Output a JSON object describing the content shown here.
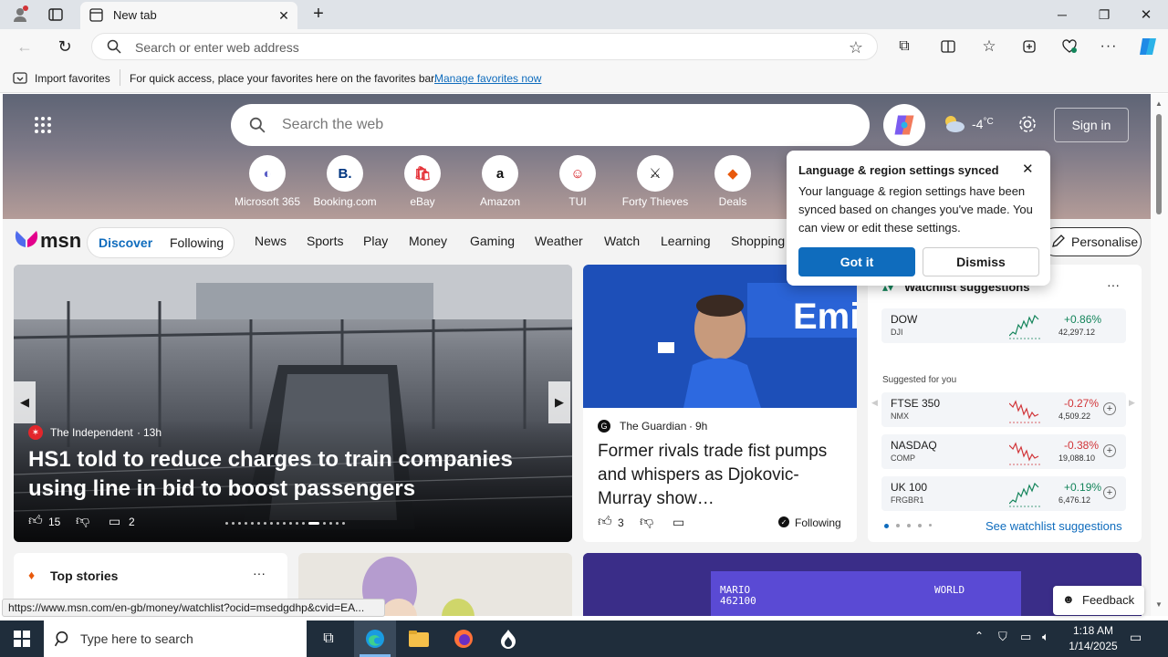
{
  "browser": {
    "tab_title": "New tab",
    "address_placeholder": "Search or enter web address",
    "favbar": {
      "import_label": "Import favorites",
      "hint": "For quick access, place your favorites here on the favorites bar.",
      "manage_link": "Manage favorites now"
    },
    "status_url": "https://www.msn.com/en-gb/money/watchlist?ocid=msedgdhp&cvid=EA..."
  },
  "msn": {
    "search_placeholder": "Search the web",
    "weather_temp": "-4",
    "weather_unit": "°C",
    "sign_in": "Sign in",
    "quick_links": [
      {
        "label": "Microsoft 365",
        "glyph": "◐",
        "color": "#5b5fc7"
      },
      {
        "label": "Booking.com",
        "glyph": "B.",
        "color": "#003580"
      },
      {
        "label": "eBay",
        "glyph": "🛍",
        "color": "#e53238"
      },
      {
        "label": "Amazon",
        "glyph": "a",
        "color": "#111111"
      },
      {
        "label": "TUI",
        "glyph": "☺",
        "color": "#d40e14"
      },
      {
        "label": "Forty Thieves",
        "glyph": "⚔",
        "color": "#111111"
      },
      {
        "label": "Deals",
        "glyph": "◆",
        "color": "#e8590c"
      }
    ],
    "logo_text": "msn",
    "feed_tabs": [
      "Discover",
      "Following"
    ],
    "nav_items": [
      "News",
      "Sports",
      "Play",
      "Money",
      "Gaming",
      "Weather",
      "Watch",
      "Learning",
      "Shopping"
    ],
    "personalise": "Personalise",
    "popup": {
      "title": "Language & region settings synced",
      "body": "Your language & region settings have been synced based on changes you've made. You can view or edit these settings.",
      "ok": "Got it",
      "dismiss": "Dismiss"
    },
    "hero": {
      "source": "The Independent",
      "age": "13h",
      "headline": "HS1 told to reduce charges to train companies using line in bid to boost passengers",
      "likes": "15",
      "comments": "2"
    },
    "story2": {
      "source": "The Guardian",
      "age": "9h",
      "headline": "Former rivals trade fist pumps and whispers as Djokovic-Murray show…",
      "likes": "3",
      "following": "Following"
    },
    "watchlist": {
      "title": "Watchlist suggestions",
      "suggested_label": "Suggested for you",
      "see_more": "See watchlist suggestions",
      "items": [
        {
          "name": "DOW",
          "sub": "DJI",
          "change": "+0.86%",
          "value": "42,297.12",
          "dir": "up"
        },
        {
          "name": "FTSE 350",
          "sub": "NMX",
          "change": "-0.27%",
          "value": "4,509.22",
          "dir": "down"
        },
        {
          "name": "NASDAQ",
          "sub": "COMP",
          "change": "-0.38%",
          "value": "19,088.10",
          "dir": "down"
        },
        {
          "name": "UK 100",
          "sub": "FRGBR1",
          "change": "+0.19%",
          "value": "6,476.12",
          "dir": "up"
        }
      ]
    },
    "top_stories": "Top stories",
    "feedback": "Feedback"
  },
  "taskbar": {
    "search_placeholder": "Type here to search",
    "time": "1:18 AM",
    "date": "1/14/2025"
  },
  "colors": {
    "accent": "#0f6cbd",
    "positive": "#13845a",
    "negative": "#d13438",
    "taskbar": "#1f2d3b"
  }
}
